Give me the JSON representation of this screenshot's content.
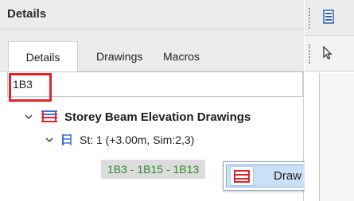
{
  "panel": {
    "title": "Details"
  },
  "tabs": [
    {
      "label": "Details",
      "active": true
    },
    {
      "label": "Drawings",
      "active": false
    },
    {
      "label": "Macros",
      "active": false
    }
  ],
  "search": {
    "value": "1B3"
  },
  "tree": {
    "root_label": "Storey Beam Elevation Drawings",
    "child_label": "St: 1 (+3.00m, Sim:2,3)",
    "leaf_label": "1B3 - 1B15 - 1B13"
  },
  "context_menu": {
    "item_label": "Draw"
  },
  "colors": {
    "highlight_border": "#e0242b",
    "leaf_text": "#2e8b2e",
    "menu_hover": "#c9e0f7"
  },
  "icons": {
    "tree_root": "beam-elevation-icon",
    "tree_child": "storey-icon",
    "menu_item": "draw-beam-icon",
    "strip_top": "document-icon",
    "strip_second": "pointer-icon"
  }
}
